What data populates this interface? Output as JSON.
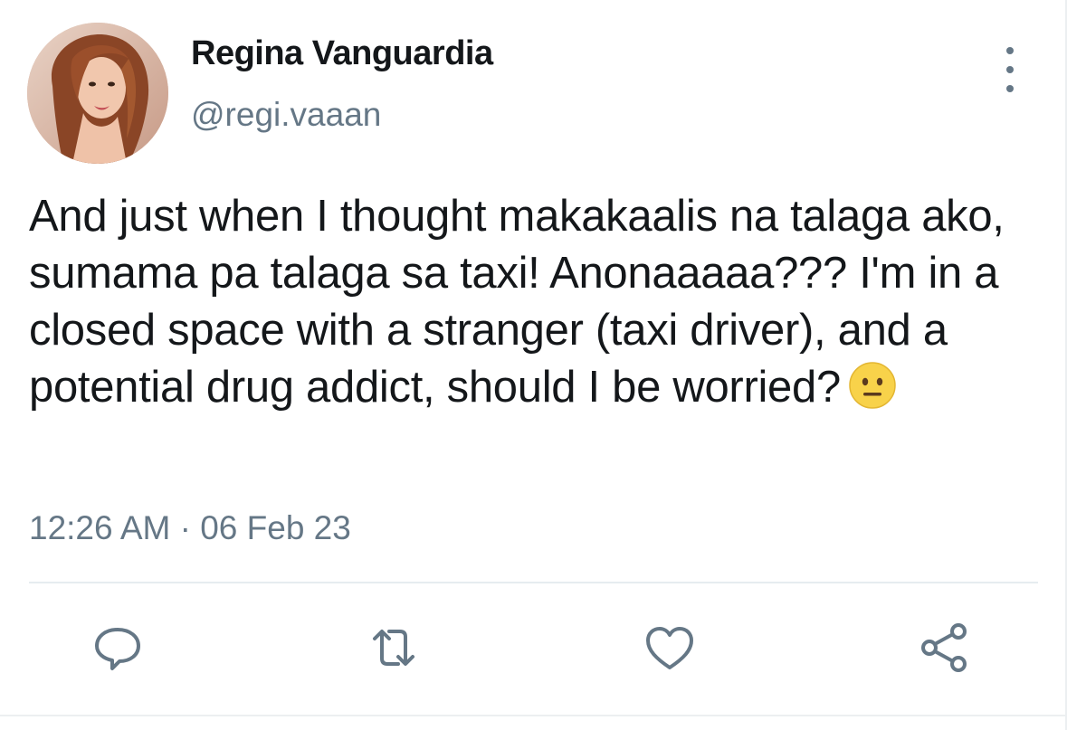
{
  "tweet": {
    "display_name": "Regina Vanguardia",
    "handle": "@regi.vaaan",
    "text": "And just when I thought makakaalis na talaga ako, sumama pa talaga sa taxi! Anonaaaaa??? I'm in a closed space with a stranger (taxi driver), and a potential drug addict, should I be worried?",
    "emoji": "neutral-face-emoji",
    "timestamp": "12:26 AM · 06 Feb 23"
  },
  "actions": [
    {
      "name": "reply",
      "icon": "speech-bubble-icon"
    },
    {
      "name": "retweet",
      "icon": "retweet-icon"
    },
    {
      "name": "like",
      "icon": "heart-icon"
    },
    {
      "name": "share",
      "icon": "share-icon"
    }
  ],
  "colors": {
    "text_primary": "#14171a",
    "text_secondary": "#657786",
    "divider": "#e6ecf0",
    "emoji_face": "#f8d24a"
  }
}
